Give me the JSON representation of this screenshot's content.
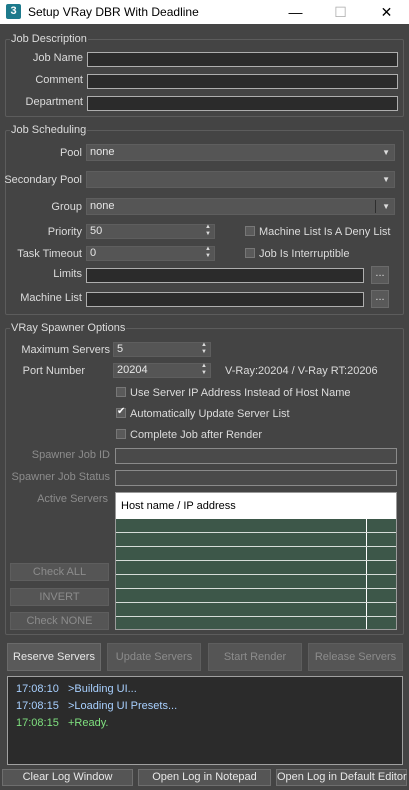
{
  "window": {
    "logo": "3",
    "title": "Setup VRay DBR With Deadline",
    "minimize": "—",
    "maximize": "☐",
    "close": "✕"
  },
  "job_description": {
    "title": "Job Description",
    "job_name_label": "Job Name",
    "job_name_value": "",
    "comment_label": "Comment",
    "comment_value": "",
    "department_label": "Department",
    "department_value": ""
  },
  "job_scheduling": {
    "title": "Job Scheduling",
    "pool_label": "Pool",
    "pool_value": "none",
    "secondary_pool_label": "Secondary Pool",
    "secondary_pool_value": "",
    "group_label": "Group",
    "group_value": "none",
    "priority_label": "Priority",
    "priority_value": "50",
    "task_timeout_label": "Task Timeout",
    "task_timeout_value": "0",
    "machine_list_deny_label": "Machine List Is A Deny List",
    "machine_list_deny_checked": false,
    "job_interruptible_label": "Job Is Interruptible",
    "job_interruptible_checked": false,
    "limits_label": "Limits",
    "limits_value": "",
    "machine_list_label": "Machine List",
    "machine_list_value": "",
    "browse_label": "..."
  },
  "spawner": {
    "title": "VRay Spawner Options",
    "max_servers_label": "Maximum Servers",
    "max_servers_value": "5",
    "port_label": "Port Number",
    "port_value": "20204",
    "port_info": "V-Ray:20204 / V-Ray RT:20206",
    "use_ip_label": "Use Server IP Address Instead of Host Name",
    "use_ip_checked": false,
    "auto_update_label": "Automatically Update Server List",
    "auto_update_checked": true,
    "complete_after_label": "Complete Job after Render",
    "complete_after_checked": false,
    "job_id_label": "Spawner Job ID",
    "job_id_value": "",
    "job_status_label": "Spawner Job Status",
    "job_status_value": "",
    "active_servers_label": "Active Servers",
    "table_header": "Host name / IP address",
    "check_all": "Check ALL",
    "invert": "INVERT",
    "check_none": "Check NONE",
    "check_mark": "✔"
  },
  "actions": {
    "reserve": "Reserve Servers",
    "update": "Update Servers",
    "start": "Start Render",
    "release": "Release Servers"
  },
  "log": [
    {
      "time": "17:08:10",
      "msg": ">Building UI..."
    },
    {
      "time": "17:08:15",
      "msg": ">Loading UI Presets..."
    },
    {
      "time": "17:08:15",
      "msg": "+Ready."
    }
  ],
  "bottom": {
    "clear": "Clear Log Window",
    "notepad": "Open Log in Notepad",
    "editor": "Open Log in Default Editor"
  },
  "colors": {
    "background": "#444444",
    "table_bg": "#3d5749",
    "log_info": "#a8d0ff",
    "log_ok": "#7fe07f"
  }
}
